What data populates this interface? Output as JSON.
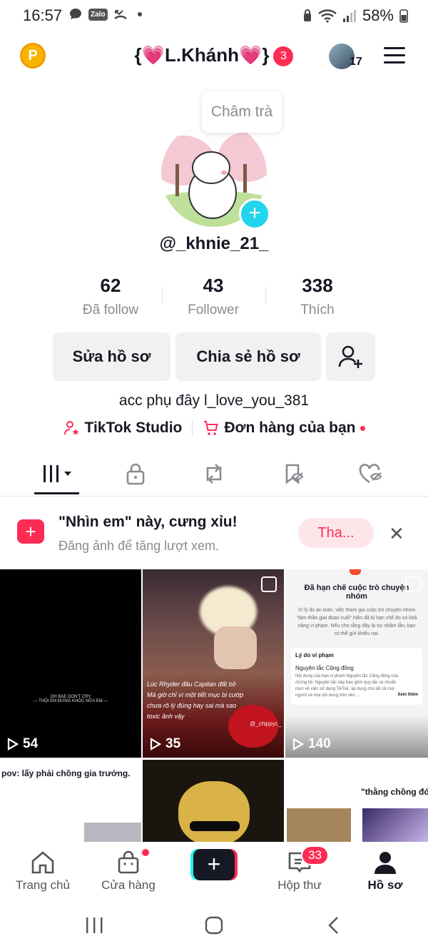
{
  "status_bar": {
    "time": "16:57",
    "zalo_label": "Zalo",
    "battery": "58%"
  },
  "header": {
    "title": "{💗L.Khánh💗}",
    "notif_count": "3",
    "accounts_count": "17"
  },
  "profile": {
    "bubble_text": "Châm trà",
    "username": "@_khnie_21_",
    "stats": [
      {
        "value": "62",
        "label": "Đã follow"
      },
      {
        "value": "43",
        "label": "Follower"
      },
      {
        "value": "338",
        "label": "Thích"
      }
    ],
    "edit_button": "Sửa hồ sơ",
    "share_button": "Chia sẻ hồ sơ",
    "bio": "acc phụ đây l_love_you_381",
    "studio_link": "TikTok Studio",
    "orders_link": "Đơn hàng của bạn"
  },
  "promo": {
    "title": "\"Nhìn em\" này, cưng xỉu!",
    "subtitle": "Đăng ảnh để tăng lượt xem.",
    "button": "Tha..."
  },
  "videos": [
    {
      "views": "54",
      "caption": "OH BAE DON'T CRY\n— THÔI EM ĐỪNG KHÓC NỮA EM —"
    },
    {
      "views": "35",
      "caption": "Lúc Rhyder đầu Capitan đất bồ\nMà giờ chỉ vì một tiết mục bị cướp\nchưa rõ lý đúng hay sai mà sao\ntoxic ảnh vậy",
      "watermark": "@_chippyc_"
    },
    {
      "views": "140",
      "card_title": "Đã hạn chế cuộc trò chuyện nhóm",
      "card_body": "Vì lý do an toàn, việc tham gia cuộc trò chuyện nhóm \"tâm thần giai đoạn cuối\" hiện đã bị hạn chế do có khả năng vi phạm. Nếu cho rằng đây là sự nhầm lẫn, bạn có thể gửi khiếu nại.",
      "reason_label": "Lý do vi phạm",
      "reason_title": "Nguyên tắc Cộng đồng",
      "reason_body": "Nội dung của bạn vi phạm Nguyên tắc Cộng đồng của chúng tôi. Nguyên tắc này bao gồm quy tắc và chuẩn mực về việc sử dụng TikTok, áp dụng cho tất cả mọi người và mọi nội dung trên nền ...",
      "see_more": "Xem thêm"
    },
    {
      "views": "",
      "caption": "pov: lấy phải chồng gia trưởng."
    },
    {
      "views": "",
      "caption": ""
    },
    {
      "views": "",
      "caption": "\"thằng chồng đó"
    }
  ],
  "bottom_nav": {
    "home": "Trang chủ",
    "shop": "Cửa hàng",
    "inbox": "Hộp thư",
    "inbox_count": "33",
    "profile": "Hồ sơ"
  }
}
